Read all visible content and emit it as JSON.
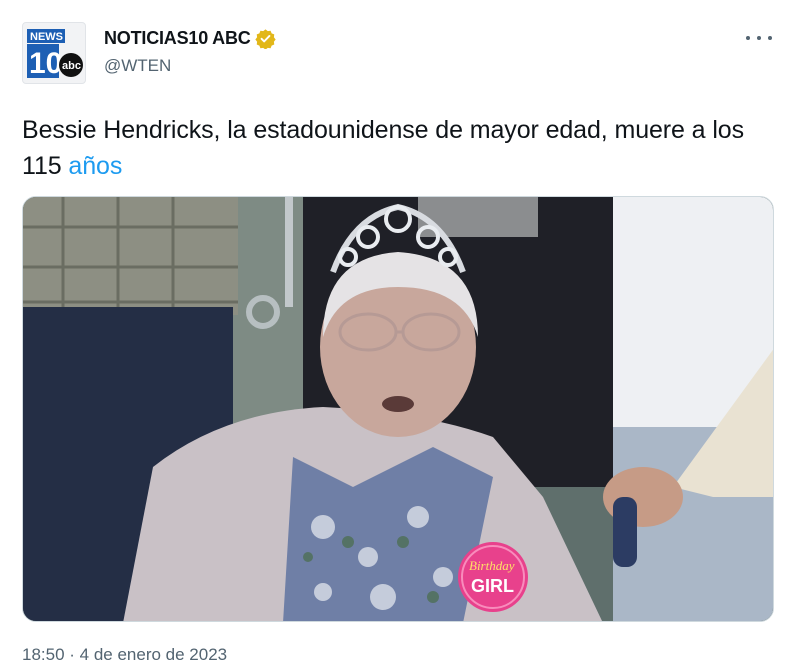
{
  "author": {
    "display_name": "NOTICIAS10 ABC",
    "handle": "@WTEN",
    "verified_badge_icon": "verified-badge-icon",
    "avatar_logo_text": {
      "top": "NEWS",
      "number": "10",
      "network": "abc"
    },
    "verified_color": "#e2b719"
  },
  "menu": {
    "icon": "more-options-icon"
  },
  "tweet": {
    "text_before": "Bessie Hendricks, la estadounidense de mayor edad, muere a los 115 ",
    "hashtag": "años",
    "link_color": "#1d9bf0"
  },
  "media": {
    "badge_line1": "Birthday",
    "badge_line2": "GIRL",
    "badge_color": "#e8418c"
  },
  "footer": {
    "timestamp": "18:50 · 4 de enero de 2023"
  }
}
